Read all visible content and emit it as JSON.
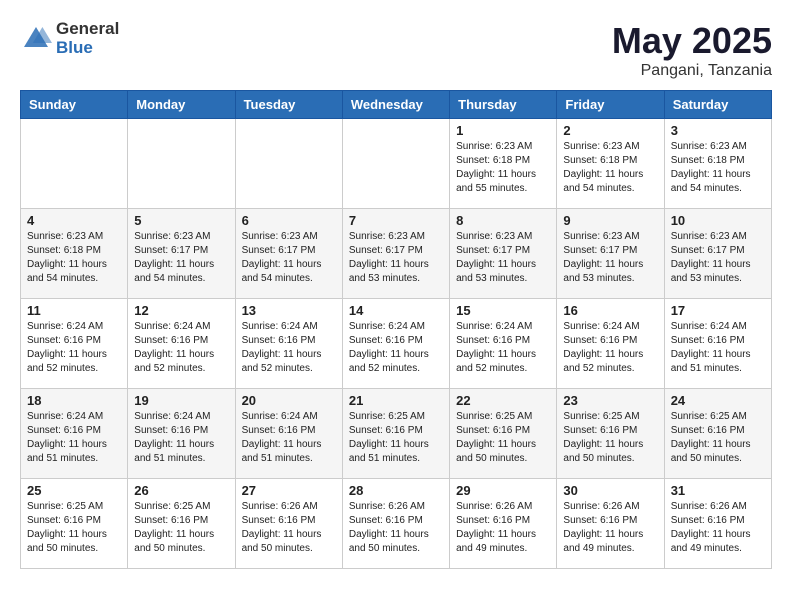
{
  "header": {
    "logo_general": "General",
    "logo_blue": "Blue",
    "title": "May 2025",
    "location": "Pangani, Tanzania"
  },
  "weekdays": [
    "Sunday",
    "Monday",
    "Tuesday",
    "Wednesday",
    "Thursday",
    "Friday",
    "Saturday"
  ],
  "weeks": [
    [
      {
        "day": "",
        "info": ""
      },
      {
        "day": "",
        "info": ""
      },
      {
        "day": "",
        "info": ""
      },
      {
        "day": "",
        "info": ""
      },
      {
        "day": "1",
        "info": "Sunrise: 6:23 AM\nSunset: 6:18 PM\nDaylight: 11 hours\nand 55 minutes."
      },
      {
        "day": "2",
        "info": "Sunrise: 6:23 AM\nSunset: 6:18 PM\nDaylight: 11 hours\nand 54 minutes."
      },
      {
        "day": "3",
        "info": "Sunrise: 6:23 AM\nSunset: 6:18 PM\nDaylight: 11 hours\nand 54 minutes."
      }
    ],
    [
      {
        "day": "4",
        "info": "Sunrise: 6:23 AM\nSunset: 6:18 PM\nDaylight: 11 hours\nand 54 minutes."
      },
      {
        "day": "5",
        "info": "Sunrise: 6:23 AM\nSunset: 6:17 PM\nDaylight: 11 hours\nand 54 minutes."
      },
      {
        "day": "6",
        "info": "Sunrise: 6:23 AM\nSunset: 6:17 PM\nDaylight: 11 hours\nand 54 minutes."
      },
      {
        "day": "7",
        "info": "Sunrise: 6:23 AM\nSunset: 6:17 PM\nDaylight: 11 hours\nand 53 minutes."
      },
      {
        "day": "8",
        "info": "Sunrise: 6:23 AM\nSunset: 6:17 PM\nDaylight: 11 hours\nand 53 minutes."
      },
      {
        "day": "9",
        "info": "Sunrise: 6:23 AM\nSunset: 6:17 PM\nDaylight: 11 hours\nand 53 minutes."
      },
      {
        "day": "10",
        "info": "Sunrise: 6:23 AM\nSunset: 6:17 PM\nDaylight: 11 hours\nand 53 minutes."
      }
    ],
    [
      {
        "day": "11",
        "info": "Sunrise: 6:24 AM\nSunset: 6:16 PM\nDaylight: 11 hours\nand 52 minutes."
      },
      {
        "day": "12",
        "info": "Sunrise: 6:24 AM\nSunset: 6:16 PM\nDaylight: 11 hours\nand 52 minutes."
      },
      {
        "day": "13",
        "info": "Sunrise: 6:24 AM\nSunset: 6:16 PM\nDaylight: 11 hours\nand 52 minutes."
      },
      {
        "day": "14",
        "info": "Sunrise: 6:24 AM\nSunset: 6:16 PM\nDaylight: 11 hours\nand 52 minutes."
      },
      {
        "day": "15",
        "info": "Sunrise: 6:24 AM\nSunset: 6:16 PM\nDaylight: 11 hours\nand 52 minutes."
      },
      {
        "day": "16",
        "info": "Sunrise: 6:24 AM\nSunset: 6:16 PM\nDaylight: 11 hours\nand 52 minutes."
      },
      {
        "day": "17",
        "info": "Sunrise: 6:24 AM\nSunset: 6:16 PM\nDaylight: 11 hours\nand 51 minutes."
      }
    ],
    [
      {
        "day": "18",
        "info": "Sunrise: 6:24 AM\nSunset: 6:16 PM\nDaylight: 11 hours\nand 51 minutes."
      },
      {
        "day": "19",
        "info": "Sunrise: 6:24 AM\nSunset: 6:16 PM\nDaylight: 11 hours\nand 51 minutes."
      },
      {
        "day": "20",
        "info": "Sunrise: 6:24 AM\nSunset: 6:16 PM\nDaylight: 11 hours\nand 51 minutes."
      },
      {
        "day": "21",
        "info": "Sunrise: 6:25 AM\nSunset: 6:16 PM\nDaylight: 11 hours\nand 51 minutes."
      },
      {
        "day": "22",
        "info": "Sunrise: 6:25 AM\nSunset: 6:16 PM\nDaylight: 11 hours\nand 50 minutes."
      },
      {
        "day": "23",
        "info": "Sunrise: 6:25 AM\nSunset: 6:16 PM\nDaylight: 11 hours\nand 50 minutes."
      },
      {
        "day": "24",
        "info": "Sunrise: 6:25 AM\nSunset: 6:16 PM\nDaylight: 11 hours\nand 50 minutes."
      }
    ],
    [
      {
        "day": "25",
        "info": "Sunrise: 6:25 AM\nSunset: 6:16 PM\nDaylight: 11 hours\nand 50 minutes."
      },
      {
        "day": "26",
        "info": "Sunrise: 6:25 AM\nSunset: 6:16 PM\nDaylight: 11 hours\nand 50 minutes."
      },
      {
        "day": "27",
        "info": "Sunrise: 6:26 AM\nSunset: 6:16 PM\nDaylight: 11 hours\nand 50 minutes."
      },
      {
        "day": "28",
        "info": "Sunrise: 6:26 AM\nSunset: 6:16 PM\nDaylight: 11 hours\nand 50 minutes."
      },
      {
        "day": "29",
        "info": "Sunrise: 6:26 AM\nSunset: 6:16 PM\nDaylight: 11 hours\nand 49 minutes."
      },
      {
        "day": "30",
        "info": "Sunrise: 6:26 AM\nSunset: 6:16 PM\nDaylight: 11 hours\nand 49 minutes."
      },
      {
        "day": "31",
        "info": "Sunrise: 6:26 AM\nSunset: 6:16 PM\nDaylight: 11 hours\nand 49 minutes."
      }
    ]
  ]
}
